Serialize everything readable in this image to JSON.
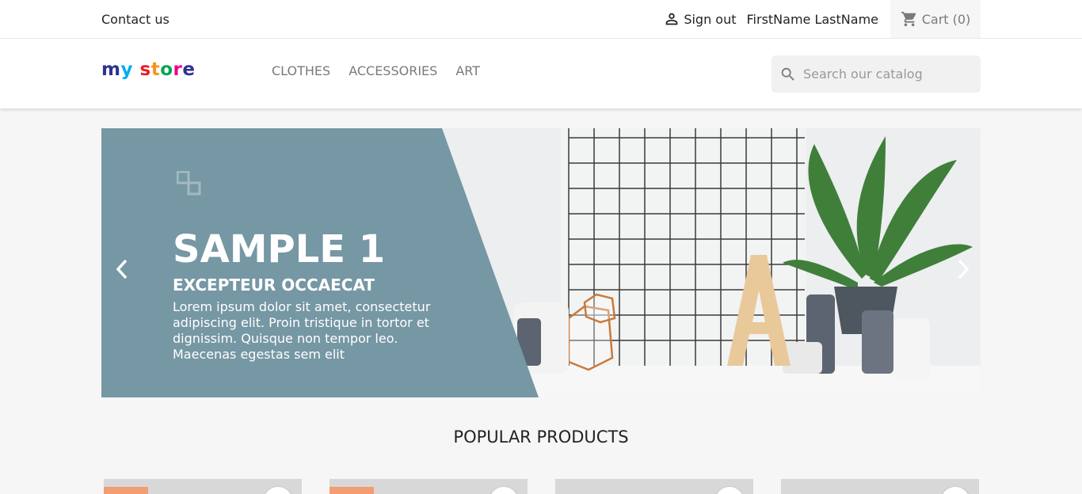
{
  "topbar": {
    "contact": "Contact us",
    "sign_out": "Sign out",
    "user_name": "FirstName LastName",
    "cart_label": "Cart",
    "cart_count": "(0)"
  },
  "header": {
    "logo_letters": [
      {
        "ch": "m",
        "color": "#2e3192"
      },
      {
        "ch": "y",
        "color": "#00aeef"
      },
      {
        "ch": " ",
        "color": "#000000"
      },
      {
        "ch": "s",
        "color": "#ec1c24"
      },
      {
        "ch": "t",
        "color": "#f7941d"
      },
      {
        "ch": "o",
        "color": "#00a651"
      },
      {
        "ch": "r",
        "color": "#ec008c"
      },
      {
        "ch": "e",
        "color": "#2e3192"
      }
    ],
    "nav": [
      "CLOTHES",
      "ACCESSORIES",
      "ART"
    ],
    "search_placeholder": "Search our catalog"
  },
  "slider": {
    "title": "SAMPLE 1",
    "subtitle": "EXCEPTEUR OCCAECAT",
    "description": "Lorem ipsum dolor sit amet, consectetur adipiscing elit. Proin tristique in tortor et dignissim. Quisque non tempor leo. Maecenas egestas sem elit",
    "panel_color": "#7697a4"
  },
  "section": {
    "title": "POPULAR PRODUCTS"
  },
  "colors": {
    "accent_badge": "#f39d72"
  }
}
